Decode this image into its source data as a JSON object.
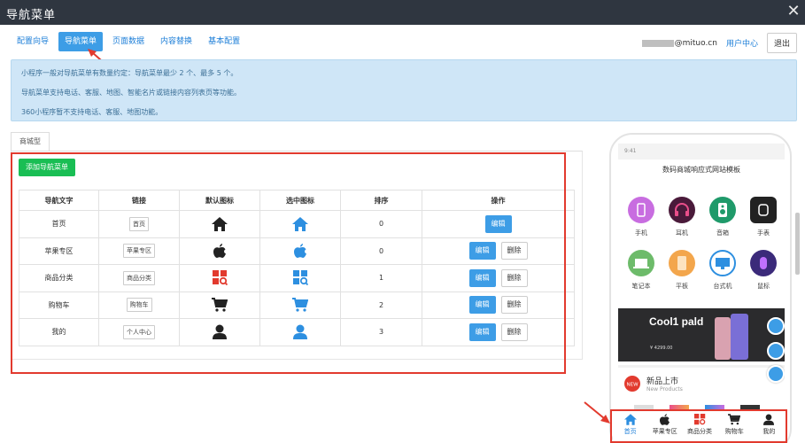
{
  "window": {
    "title": "导航菜单"
  },
  "tabs": [
    {
      "label": "配置向导"
    },
    {
      "label": "导航菜单"
    },
    {
      "label": "页面数据"
    },
    {
      "label": "内容替换"
    },
    {
      "label": "基本配置"
    }
  ],
  "account": {
    "email_suffix": "@mituo.cn",
    "user_center": "用户中心",
    "logout": "退出"
  },
  "notice": [
    "小程序一般对导航菜单有数量约定：导航菜单最少 2 个、最多 5 个。",
    "导航菜单支持电话、客服、地图、智能名片或链接内容列表页等功能。",
    "360小程序暂不支持电话、客服、地图功能。"
  ],
  "subtab": "商城型",
  "add_button": "添加导航菜单",
  "table": {
    "headers": [
      "导航文字",
      "链接",
      "默认图标",
      "选中图标",
      "排序",
      "操作"
    ],
    "rows": [
      {
        "text": "首页",
        "link": "首页",
        "icon": "home-icon",
        "order": "0",
        "edit": "编辑",
        "delete": ""
      },
      {
        "text": "苹果专区",
        "link": "苹果专区",
        "icon": "apple-icon",
        "order": "0",
        "edit": "编辑",
        "delete": "删除"
      },
      {
        "text": "商品分类",
        "link": "商品分类",
        "icon": "category-icon",
        "order": "1",
        "edit": "编辑",
        "delete": "删除"
      },
      {
        "text": "购物车",
        "link": "购物车",
        "icon": "cart-icon",
        "order": "2",
        "edit": "编辑",
        "delete": "删除"
      },
      {
        "text": "我的",
        "link": "个人中心",
        "icon": "user-icon",
        "order": "3",
        "edit": "编辑",
        "delete": "删除"
      }
    ]
  },
  "colors": {
    "active_blue": "#3d9de6",
    "dark_icon": "#222222",
    "category_red": "#e23a2e",
    "add_green": "#19be54"
  },
  "phone": {
    "time": "9:41",
    "title": "数码商城响应式网站模板",
    "categories": [
      "手机",
      "耳机",
      "音箱",
      "手表",
      "笔记本",
      "平板",
      "台式机",
      "鼠标"
    ],
    "banner_title": "Cool1 pald",
    "banner_price": "¥ 4299.00",
    "new_title": "新品上市",
    "new_sub": "New Products",
    "new_badge": "NEW",
    "nav": [
      "首页",
      "苹果专区",
      "商品分类",
      "购物车",
      "我的"
    ]
  }
}
